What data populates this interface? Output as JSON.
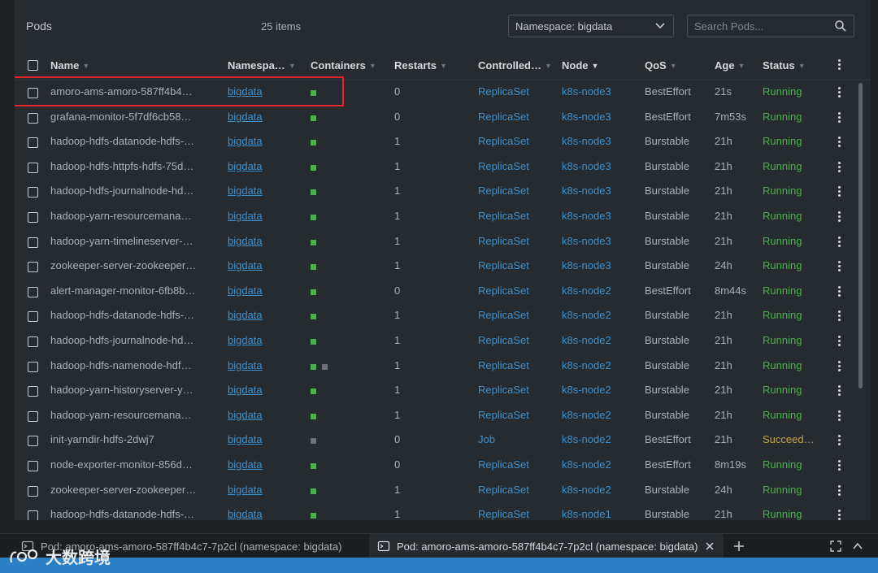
{
  "toolbar": {
    "title": "Pods",
    "items_count": "25 items",
    "namespace_select": "Namespace: bigdata",
    "search_placeholder": "Search Pods..."
  },
  "columns": [
    "Name",
    "Namespa…",
    "Containers",
    "Restarts",
    "Controlled…",
    "Node",
    "QoS",
    "Age",
    "Status"
  ],
  "colors": {
    "running": "#4caf50",
    "succeeded": "#c6a34a",
    "link": "#3d90ce",
    "container_ok": "#4caf50",
    "container_gray": "#6b7278",
    "highlight": "#e0242d",
    "footer_strip": "#2a7fc7"
  },
  "pods": [
    {
      "name": "amoro-ams-amoro-587ff4b4…",
      "namespace": "bigdata",
      "containers": [
        "running"
      ],
      "restarts": "0",
      "controlled_by": "ReplicaSet",
      "node": "k8s-node3",
      "qos": "BestEffort",
      "age": "21s",
      "status": "Running"
    },
    {
      "name": "grafana-monitor-5f7df6cb58…",
      "namespace": "bigdata",
      "containers": [
        "running"
      ],
      "restarts": "0",
      "controlled_by": "ReplicaSet",
      "node": "k8s-node3",
      "qos": "BestEffort",
      "age": "7m53s",
      "status": "Running"
    },
    {
      "name": "hadoop-hdfs-datanode-hdfs-…",
      "namespace": "bigdata",
      "containers": [
        "running"
      ],
      "restarts": "1",
      "controlled_by": "ReplicaSet",
      "node": "k8s-node3",
      "qos": "Burstable",
      "age": "21h",
      "status": "Running"
    },
    {
      "name": "hadoop-hdfs-httpfs-hdfs-75d…",
      "namespace": "bigdata",
      "containers": [
        "running"
      ],
      "restarts": "1",
      "controlled_by": "ReplicaSet",
      "node": "k8s-node3",
      "qos": "Burstable",
      "age": "21h",
      "status": "Running"
    },
    {
      "name": "hadoop-hdfs-journalnode-hd…",
      "namespace": "bigdata",
      "containers": [
        "running"
      ],
      "restarts": "1",
      "controlled_by": "ReplicaSet",
      "node": "k8s-node3",
      "qos": "Burstable",
      "age": "21h",
      "status": "Running"
    },
    {
      "name": "hadoop-yarn-resourcemanag…",
      "namespace": "bigdata",
      "containers": [
        "running"
      ],
      "restarts": "1",
      "controlled_by": "ReplicaSet",
      "node": "k8s-node3",
      "qos": "Burstable",
      "age": "21h",
      "status": "Running"
    },
    {
      "name": "hadoop-yarn-timelineserver-y…",
      "namespace": "bigdata",
      "containers": [
        "running"
      ],
      "restarts": "1",
      "controlled_by": "ReplicaSet",
      "node": "k8s-node3",
      "qos": "Burstable",
      "age": "21h",
      "status": "Running"
    },
    {
      "name": "zookeeper-server-zookeeper-…",
      "namespace": "bigdata",
      "containers": [
        "running"
      ],
      "restarts": "1",
      "controlled_by": "ReplicaSet",
      "node": "k8s-node3",
      "qos": "Burstable",
      "age": "24h",
      "status": "Running"
    },
    {
      "name": "alert-manager-monitor-6fb8b…",
      "namespace": "bigdata",
      "containers": [
        "running"
      ],
      "restarts": "0",
      "controlled_by": "ReplicaSet",
      "node": "k8s-node2",
      "qos": "BestEffort",
      "age": "8m44s",
      "status": "Running"
    },
    {
      "name": "hadoop-hdfs-datanode-hdfs-…",
      "namespace": "bigdata",
      "containers": [
        "running"
      ],
      "restarts": "1",
      "controlled_by": "ReplicaSet",
      "node": "k8s-node2",
      "qos": "Burstable",
      "age": "21h",
      "status": "Running"
    },
    {
      "name": "hadoop-hdfs-journalnode-hd…",
      "namespace": "bigdata",
      "containers": [
        "running"
      ],
      "restarts": "1",
      "controlled_by": "ReplicaSet",
      "node": "k8s-node2",
      "qos": "Burstable",
      "age": "21h",
      "status": "Running"
    },
    {
      "name": "hadoop-hdfs-namenode-hdf…",
      "namespace": "bigdata",
      "containers": [
        "running",
        "gray"
      ],
      "restarts": "1",
      "controlled_by": "ReplicaSet",
      "node": "k8s-node2",
      "qos": "Burstable",
      "age": "21h",
      "status": "Running"
    },
    {
      "name": "hadoop-yarn-historyserver-y…",
      "namespace": "bigdata",
      "containers": [
        "running"
      ],
      "restarts": "1",
      "controlled_by": "ReplicaSet",
      "node": "k8s-node2",
      "qos": "Burstable",
      "age": "21h",
      "status": "Running"
    },
    {
      "name": "hadoop-yarn-resourcemanag…",
      "namespace": "bigdata",
      "containers": [
        "running"
      ],
      "restarts": "1",
      "controlled_by": "ReplicaSet",
      "node": "k8s-node2",
      "qos": "Burstable",
      "age": "21h",
      "status": "Running"
    },
    {
      "name": "init-yarndir-hdfs-2dwj7",
      "namespace": "bigdata",
      "containers": [
        "gray"
      ],
      "restarts": "0",
      "controlled_by": "Job",
      "node": "k8s-node2",
      "qos": "BestEffort",
      "age": "21h",
      "status": "Succeed…"
    },
    {
      "name": "node-exporter-monitor-856d…",
      "namespace": "bigdata",
      "containers": [
        "running"
      ],
      "restarts": "0",
      "controlled_by": "ReplicaSet",
      "node": "k8s-node2",
      "qos": "BestEffort",
      "age": "8m19s",
      "status": "Running"
    },
    {
      "name": "zookeeper-server-zookeeper-…",
      "namespace": "bigdata",
      "containers": [
        "running"
      ],
      "restarts": "1",
      "controlled_by": "ReplicaSet",
      "node": "k8s-node2",
      "qos": "Burstable",
      "age": "24h",
      "status": "Running"
    },
    {
      "name": "hadoop-hdfs-datanode-hdfs-…",
      "namespace": "bigdata",
      "containers": [
        "running"
      ],
      "restarts": "1",
      "controlled_by": "ReplicaSet",
      "node": "k8s-node1",
      "qos": "Burstable",
      "age": "21h",
      "status": "Running"
    }
  ],
  "dock": {
    "tab1": "Pod: amoro-ams-amoro-587ff4b4c7-7p2cl (namespace: bigdata)",
    "tab2": "Pod: amoro-ams-amoro-587ff4b4c7-7p2cl (namespace: bigdata)"
  },
  "watermark": "大数跨境"
}
